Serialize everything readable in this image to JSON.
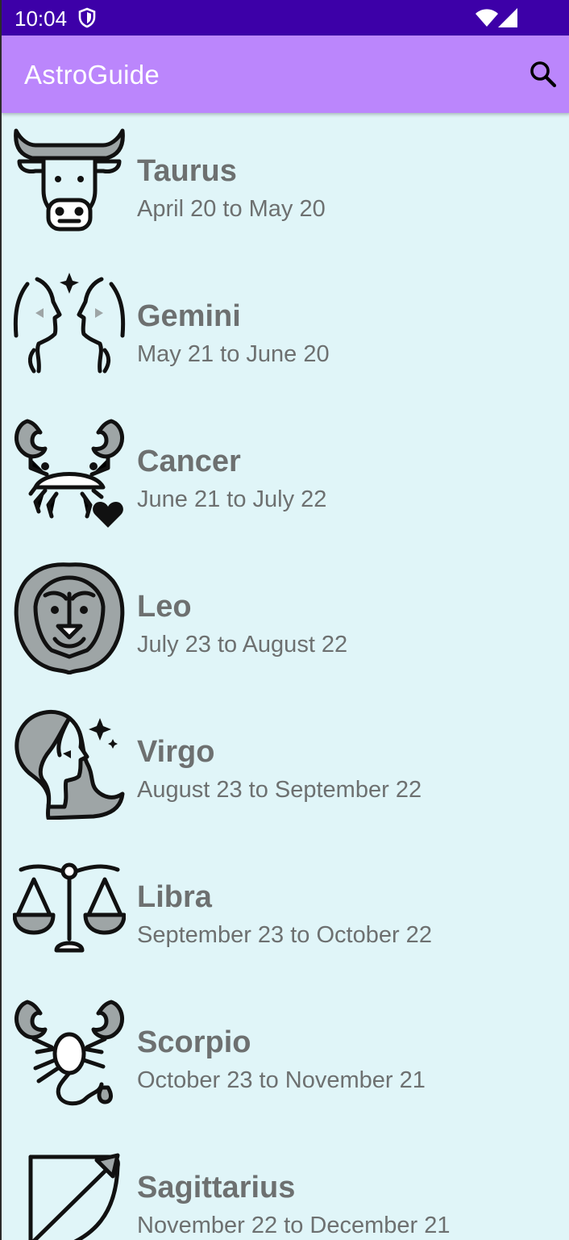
{
  "status_bar": {
    "time": "10:04",
    "background": "#3d00a8",
    "icons": [
      "shield-icon",
      "wifi-icon",
      "cell-signal-icon"
    ]
  },
  "app_bar": {
    "title": "AstroGuide",
    "background": "#bb86fc",
    "search_icon": "search-icon"
  },
  "colors": {
    "list_background": "#e0f5f8",
    "text": "#6d7070",
    "icon_fill": "#9ea5a6",
    "icon_stroke": "#111111"
  },
  "signs": [
    {
      "name": "Taurus",
      "dates": "April 20 to May 20",
      "icon": "taurus-icon"
    },
    {
      "name": "Gemini",
      "dates": "May 21 to June 20",
      "icon": "gemini-icon"
    },
    {
      "name": "Cancer",
      "dates": "June 21 to July 22",
      "icon": "cancer-icon"
    },
    {
      "name": "Leo",
      "dates": "July 23 to August 22",
      "icon": "leo-icon"
    },
    {
      "name": "Virgo",
      "dates": "August 23 to September 22",
      "icon": "virgo-icon"
    },
    {
      "name": "Libra",
      "dates": "September 23 to October 22",
      "icon": "libra-icon"
    },
    {
      "name": "Scorpio",
      "dates": "October 23 to November 21",
      "icon": "scorpio-icon"
    },
    {
      "name": "Sagittarius",
      "dates": "November 22 to December 21",
      "icon": "sagittarius-icon"
    }
  ]
}
